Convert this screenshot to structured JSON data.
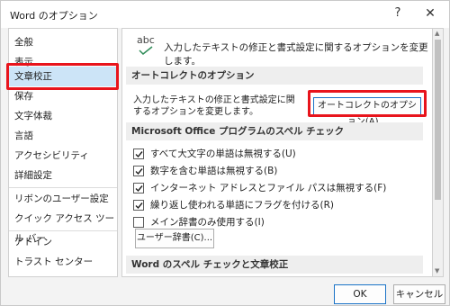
{
  "window": {
    "title": "Word のオプション",
    "help_glyph": "?",
    "close_glyph": "✕"
  },
  "sidebar": {
    "items": [
      {
        "label": "全般"
      },
      {
        "label": "表示"
      },
      {
        "label": "文章校正",
        "selected": true
      },
      {
        "label": "保存"
      },
      {
        "label": "文字体裁"
      },
      {
        "label": "言語"
      },
      {
        "label": "アクセシビリティ"
      },
      {
        "label": "詳細設定"
      },
      {
        "label": "リボンのユーザー設定"
      },
      {
        "label": "クイック アクセス ツール バー"
      },
      {
        "label": "アドイン"
      },
      {
        "label": "トラスト センター"
      }
    ]
  },
  "main": {
    "abc_icon_text": "abc",
    "intro": "入力したテキストの修正と書式設定に関するオプションを変更します。",
    "autocorrect_section": {
      "header": "オートコレクトのオプション",
      "description": "入力したテキストの修正と書式設定に関するオプションを変更します。",
      "button_label": "オートコレクトのオプション(A)..."
    },
    "spelling_section": {
      "header": "Microsoft Office プログラムのスペル チェック",
      "options": [
        {
          "label": "すべて大文字の単語は無視する(U)",
          "checked": true
        },
        {
          "label": "数字を含む単語は無視する(B)",
          "checked": true
        },
        {
          "label": "インターネット アドレスとファイル パスは無視する(F)",
          "checked": true
        },
        {
          "label": "繰り返し使われる単語にフラグを付ける(R)",
          "checked": true
        },
        {
          "label": "メイン辞書のみ使用する(I)",
          "checked": false
        }
      ],
      "dictionary_button": "ユーザー辞書(C)..."
    },
    "word_section": {
      "header": "Word のスペル チェックと文章校正"
    }
  },
  "footer": {
    "ok_label": "OK",
    "cancel_label": "キャンセル"
  },
  "colors": {
    "accent": "#1a73c7",
    "highlight": "#e8141c",
    "selected_bg": "#cce4f7",
    "check_green": "#2e8b57"
  }
}
